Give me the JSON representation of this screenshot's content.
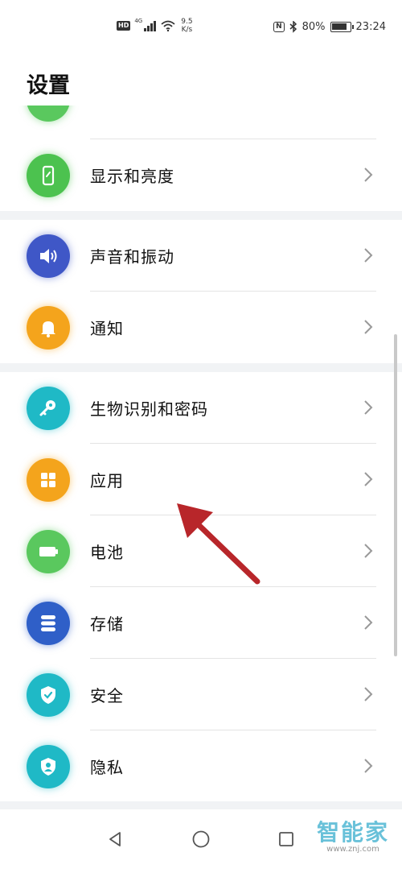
{
  "status_bar": {
    "hd": "HD",
    "signal_type": "4G",
    "net_speed_value": "9.5",
    "net_speed_unit": "K/s",
    "nfc": "N",
    "battery": "80%",
    "time": "23:24"
  },
  "header": {
    "title": "设置"
  },
  "items": [
    {
      "label": "显示和亮度",
      "icon": "display-brightness-icon",
      "color": "#4cc24f"
    },
    {
      "label": "声音和振动",
      "icon": "speaker-icon",
      "color": "#3f57c7"
    },
    {
      "label": "通知",
      "icon": "bell-icon",
      "color": "#f4a41c"
    },
    {
      "label": "生物识别和密码",
      "icon": "key-icon",
      "color": "#1fb9c6"
    },
    {
      "label": "应用",
      "icon": "apps-grid-icon",
      "color": "#f4a41c"
    },
    {
      "label": "电池",
      "icon": "battery-icon",
      "color": "#5ac85e"
    },
    {
      "label": "存储",
      "icon": "storage-icon",
      "color": "#2f5fc8"
    },
    {
      "label": "安全",
      "icon": "shield-check-icon",
      "color": "#1fb9c6"
    },
    {
      "label": "隐私",
      "icon": "privacy-icon",
      "color": "#1fb9c6"
    }
  ],
  "annotation": {
    "arrow_color": "#b8262a",
    "target": "应用"
  },
  "watermark": {
    "logo": "智能家",
    "url": "www.znj.com"
  }
}
